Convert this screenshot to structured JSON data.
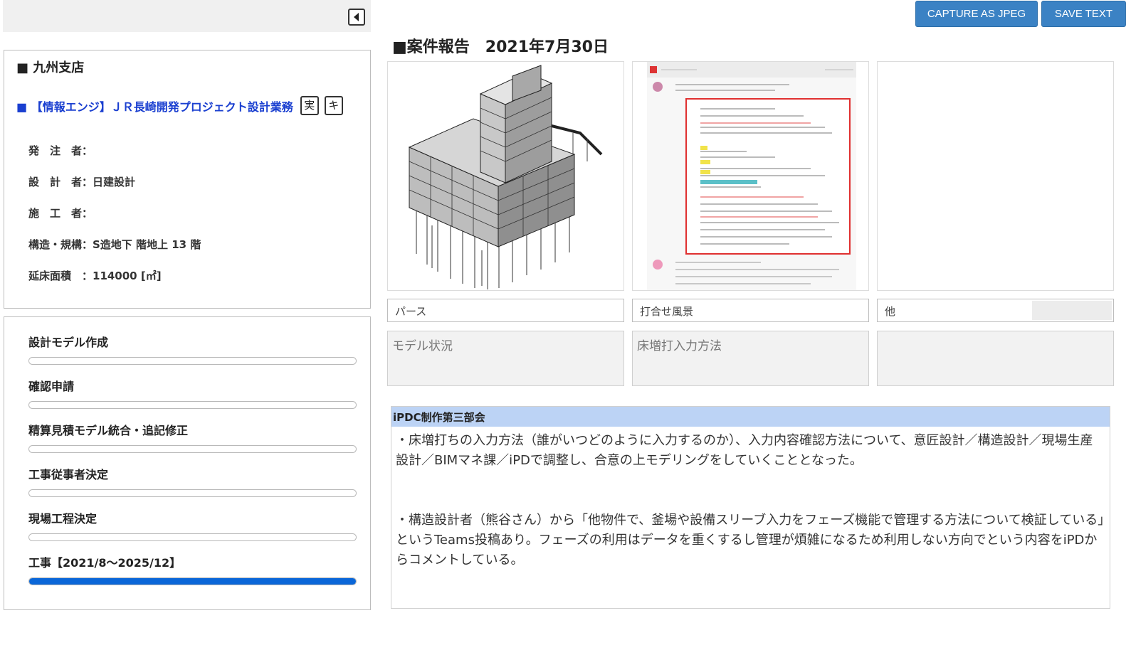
{
  "sidebar": {
    "branch": "■ 九州支店",
    "project": "■ 【情報エンジ】ＪＲ長崎開発プロジェクト設計業務",
    "project_tags": [
      "実",
      "キ"
    ],
    "fields": [
      "発　注　者：",
      "設　計　者：日建設計",
      "施　工　者：",
      "構造・規構：S造地下 階地上 13 階",
      "延床面積　：114000 [㎡]"
    ],
    "stages": [
      {
        "label": "設計モデル作成",
        "progress": 0
      },
      {
        "label": "確認申請",
        "progress": 0
      },
      {
        "label": "精算見積モデル統合・追記修正",
        "progress": 0
      },
      {
        "label": "工事従事者決定",
        "progress": 0
      },
      {
        "label": "現場工程決定",
        "progress": 0
      },
      {
        "label": "工事【2021/8〜2025/12】",
        "progress": 1
      }
    ]
  },
  "toolbar": {
    "capture_label": "CAPTURE AS JPEG",
    "save_label": "SAVE TEXT"
  },
  "report": {
    "title": "■案件報告　2021年7月30日",
    "photos": [
      {
        "caption": "パース",
        "description": "モデル状況"
      },
      {
        "caption": "打合せ風景",
        "description": "床増打入力方法"
      },
      {
        "caption": "他",
        "description": ""
      }
    ],
    "comment": {
      "header": "iPDC制作第三部会",
      "paragraphs": [
        "・床増打ちの入力方法（誰がいつどのように入力するのか）、入力内容確認方法について、意匠設計／構造設計／現場生産設計／BIMマネ課／iPDで調整し、合意の上モデリングをしていくこととなった。",
        "・構造設計者（熊谷さん）から「他物件で、釜場や設備スリーブ入力をフェーズ機能で管理する方法について検証している」というTeams投稿あり。フェーズの利用はデータを重くするし管理が煩雑になるため利用しない方向でという内容をiPDからコメントしている。"
      ]
    }
  }
}
